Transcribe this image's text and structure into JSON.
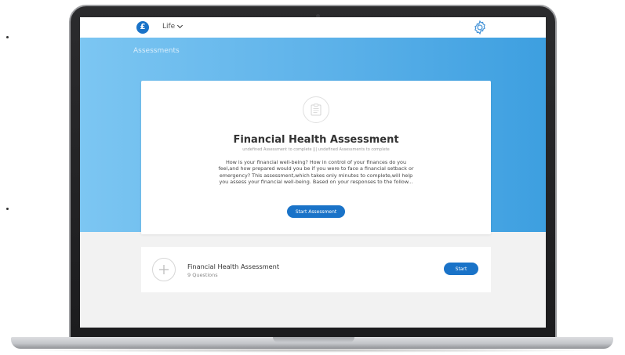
{
  "header": {
    "logo_glyph": "£",
    "menu_label": "Life",
    "settings_icon": "gear-icon"
  },
  "hero": {
    "section_label": "Assessments"
  },
  "featured": {
    "icon": "clipboard-icon",
    "title": "Financial Health Assessment",
    "subtitle": "undefined Assessment to complete ||| undefined Assessments to complete",
    "description": "How is your financial well-being? How in control of your finances do you feel,and how prepared would you be if you were to face a financial setback or emergency? This assessment,which takes only minutes to complete,will help you assess your financial well-being. Based on your responses to the follow...",
    "button_label": "Start Assessment"
  },
  "assessments": [
    {
      "icon": "plus-icon",
      "title": "Financial Health Assessment",
      "questions": "9 Questions",
      "button_label": "Start"
    }
  ],
  "colors": {
    "brand_blue": "#1a73c8",
    "hero_start": "#7cc6f2",
    "hero_end": "#3d9fe0"
  }
}
